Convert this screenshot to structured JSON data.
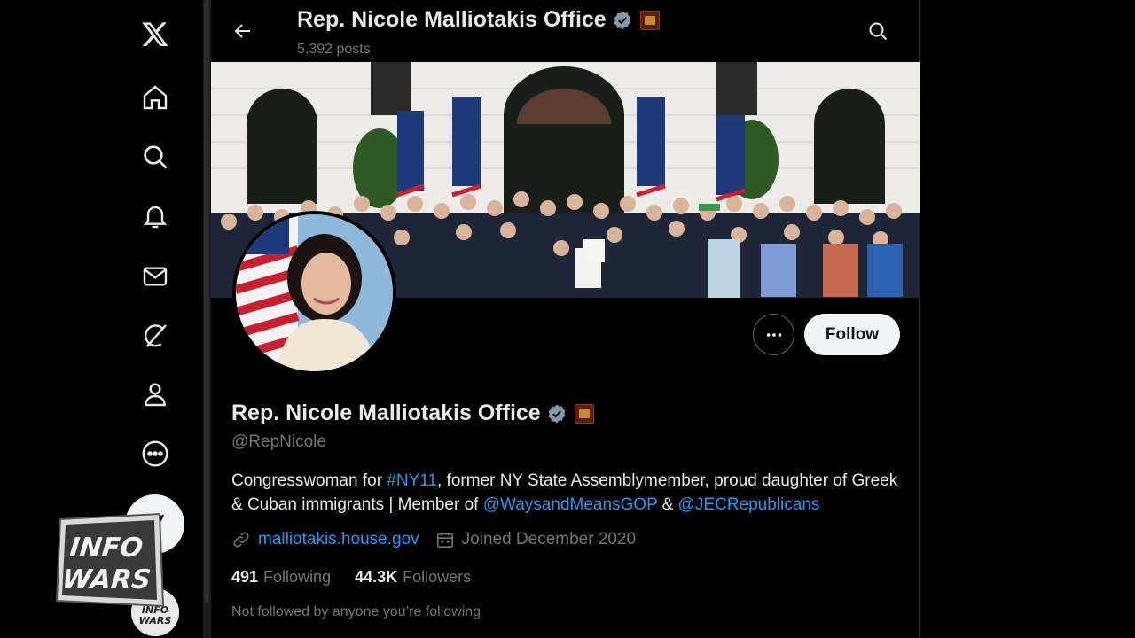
{
  "header": {
    "title": "Rep. Nicole Malliotakis Office",
    "posts": "5,392 posts"
  },
  "profile": {
    "name": "Rep. Nicole Malliotakis Office",
    "handle": "@RepNicole",
    "bio": {
      "part1": "Congresswoman for ",
      "hashtag": "#NY11",
      "part2": ", former NY State Assemblymember, proud daughter of Greek & Cuban immigrants | Member of ",
      "mention1": "@WaysandMeansGOP",
      "part3": " & ",
      "mention2": "@JECRepublicans"
    },
    "website": "malliotakis.house.gov",
    "joined": "Joined December 2020",
    "following_count": "491",
    "following_label": "Following",
    "followers_count": "44.3K",
    "followers_label": "Followers",
    "not_followed_text": "Not followed by anyone you’re following"
  },
  "actions": {
    "follow_label": "Follow"
  },
  "watermark": {
    "logo_text": "INFOWARS"
  },
  "colors": {
    "accent": "#1d9bf0",
    "verified": "#829aab",
    "background": "#000000",
    "secondary_text": "#71767b"
  },
  "nav": {
    "icons": [
      "x-logo-icon",
      "home-icon",
      "search-icon",
      "notifications-icon",
      "messages-icon",
      "grok-icon",
      "profile-icon",
      "more-icon"
    ]
  }
}
